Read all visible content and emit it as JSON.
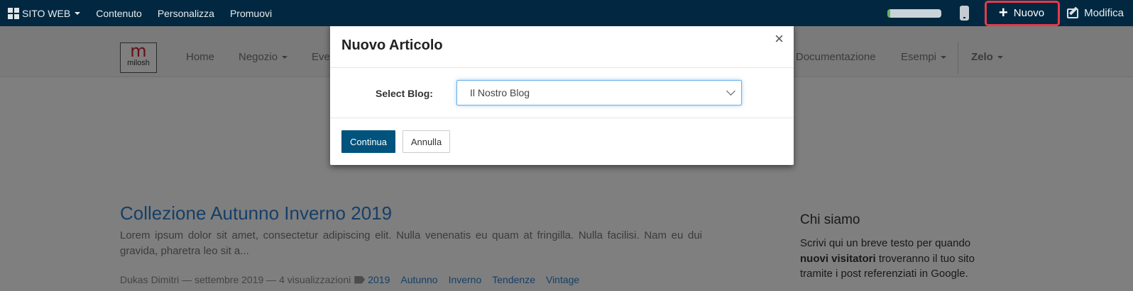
{
  "topbar": {
    "site_menu": "SITO WEB",
    "items": [
      "Contenuto",
      "Personalizza",
      "Promuovi"
    ],
    "progress": 0.06,
    "new_label": "Nuovo",
    "edit_label": "Modifica",
    "colors": {
      "background": "#012840",
      "highlight_border": "#e53b4a"
    }
  },
  "site": {
    "logo_mark": "m",
    "logo_text": "milosh",
    "nav": [
      "Home",
      "Negozio",
      "Eve",
      "Documentazione",
      "Esempi",
      "Zelo"
    ],
    "post": {
      "title": "Collezione Autunno Inverno 2019",
      "excerpt": "Lorem ipsum dolor sit amet, consectetur adipiscing elit. Nulla venenatis eu quam at fringilla. Nulla facilisi. Nam eu dui gravida, pharetra leo sit a...",
      "meta": "Dukas Dimitri — settembre 2019 — 4 visualizzazioni",
      "tags": [
        "2019",
        "Autunno",
        "Inverno",
        "Tendenze",
        "Vintage"
      ]
    },
    "about": {
      "title": "Chi siamo",
      "text_before": "Scrivi qui un breve testo per quando",
      "text_bold": "nuovi visitatori",
      "text_after": "troveranno il tuo sito tramite i post referenziati in Google."
    }
  },
  "modal": {
    "title": "Nuovo Articolo",
    "close": "×",
    "select_label": "Select Blog:",
    "select_value": "Il Nostro Blog",
    "continue_label": "Continua",
    "cancel_label": "Annulla",
    "colors": {
      "primary": "#00537c"
    }
  }
}
